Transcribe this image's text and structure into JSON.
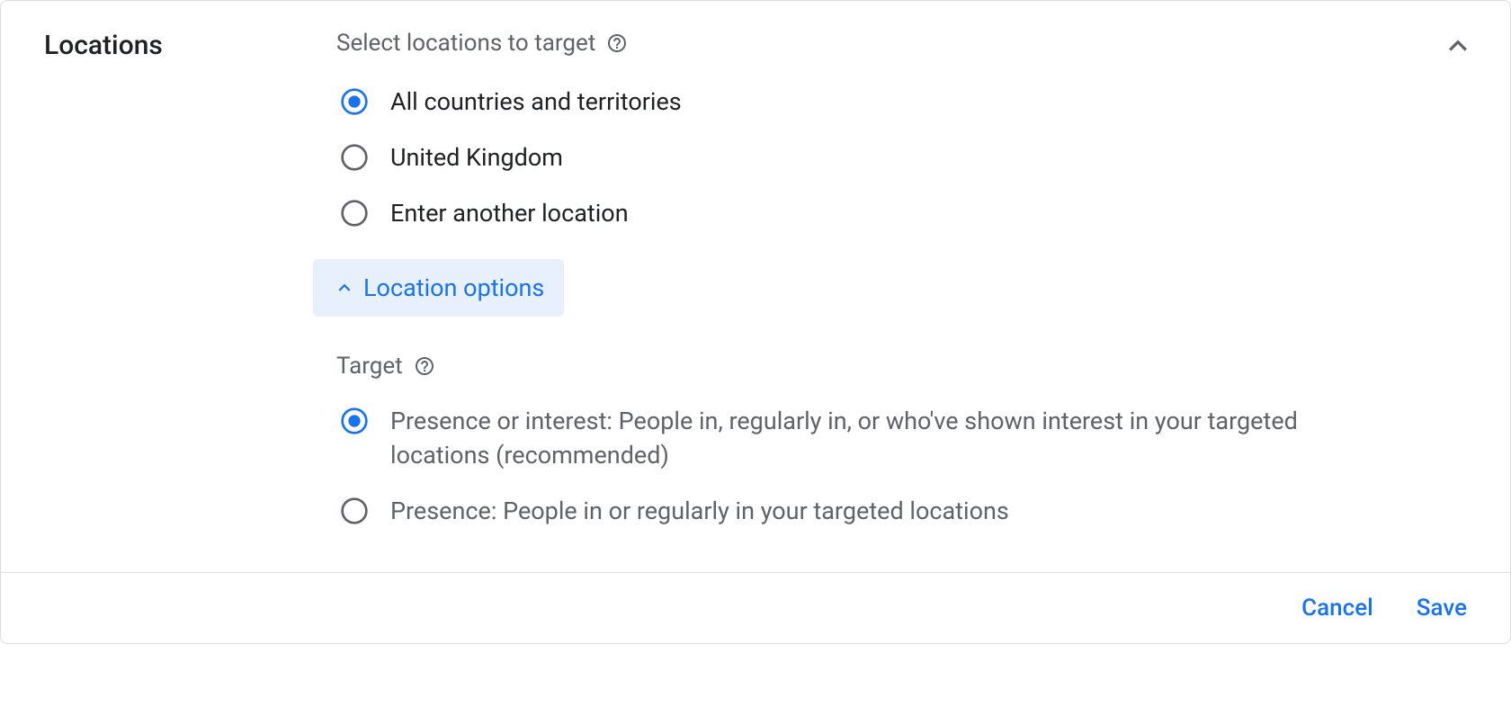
{
  "section": {
    "title": "Locations",
    "subtitle": "Select locations to target"
  },
  "location_radios": {
    "selected": 0,
    "options": [
      "All countries and territories",
      "United Kingdom",
      "Enter another location"
    ]
  },
  "expandable": {
    "label": "Location options"
  },
  "target_section": {
    "title": "Target",
    "selected": 0,
    "options": [
      "Presence or interest: People in, regularly in, or who've shown interest in your targeted locations (recommended)",
      "Presence: People in or regularly in your targeted locations"
    ]
  },
  "footer": {
    "cancel": "Cancel",
    "save": "Save"
  },
  "colors": {
    "primary_blue": "#1a73e8",
    "text_primary": "#202124",
    "text_secondary": "#5f6368",
    "light_blue_bg": "#e8f0fe",
    "border": "#dadce0"
  }
}
